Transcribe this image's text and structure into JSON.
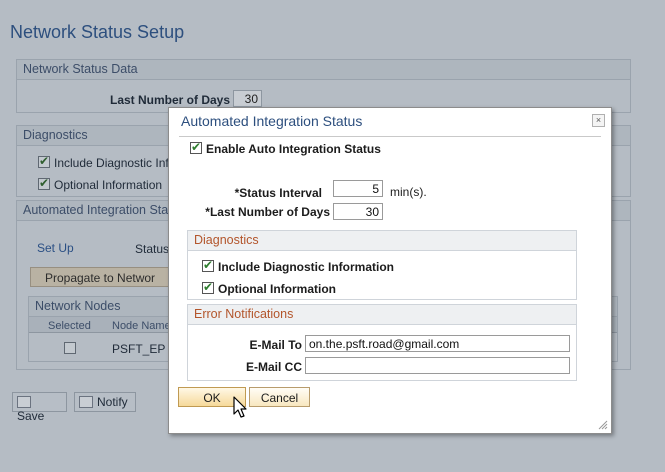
{
  "page": {
    "title": "Network Status Setup",
    "network_status_data": {
      "header": "Network Status Data",
      "last_days_label": "Last Number of Days",
      "last_days_value": "30"
    },
    "diagnostics": {
      "header": "Diagnostics",
      "include_label": "Include Diagnostic Info",
      "include_checked": true,
      "optional_label": "Optional Information",
      "optional_checked": true
    },
    "automated": {
      "header": "Automated Integration Stat",
      "setup_link": "Set Up",
      "status_label": "Status",
      "propagate_button": "Propagate to Networ"
    },
    "network_nodes": {
      "header": "Network Nodes",
      "columns": [
        "Selected",
        "Node Name"
      ],
      "rows": [
        {
          "selected": false,
          "node": "PSFT_EP"
        }
      ]
    },
    "toolbar": {
      "save": "Save",
      "notify": "Notify"
    }
  },
  "modal": {
    "title": "Automated Integration Status",
    "close_glyph": "×",
    "enable_label": "Enable Auto Integration Status",
    "enable_checked": true,
    "status_interval": {
      "label": "*Status Interval",
      "value": "5",
      "unit": "min(s)."
    },
    "last_days": {
      "label": "*Last Number of Days",
      "value": "30"
    },
    "diagnostics": {
      "header": "Diagnostics",
      "include_label": "Include Diagnostic Information",
      "include_checked": true,
      "optional_label": "Optional Information",
      "optional_checked": true
    },
    "error_notifications": {
      "header": "Error Notifications",
      "email_to_label": "E-Mail To",
      "email_to_value": "on.the.psft.road@gmail.com",
      "email_cc_label": "E-Mail CC",
      "email_cc_value": ""
    },
    "ok_button": "OK",
    "cancel_button": "Cancel"
  },
  "colors": {
    "title_blue": "#2d4f7e",
    "section_orange": "#b3552b",
    "button_gold": "#f6d99a"
  }
}
